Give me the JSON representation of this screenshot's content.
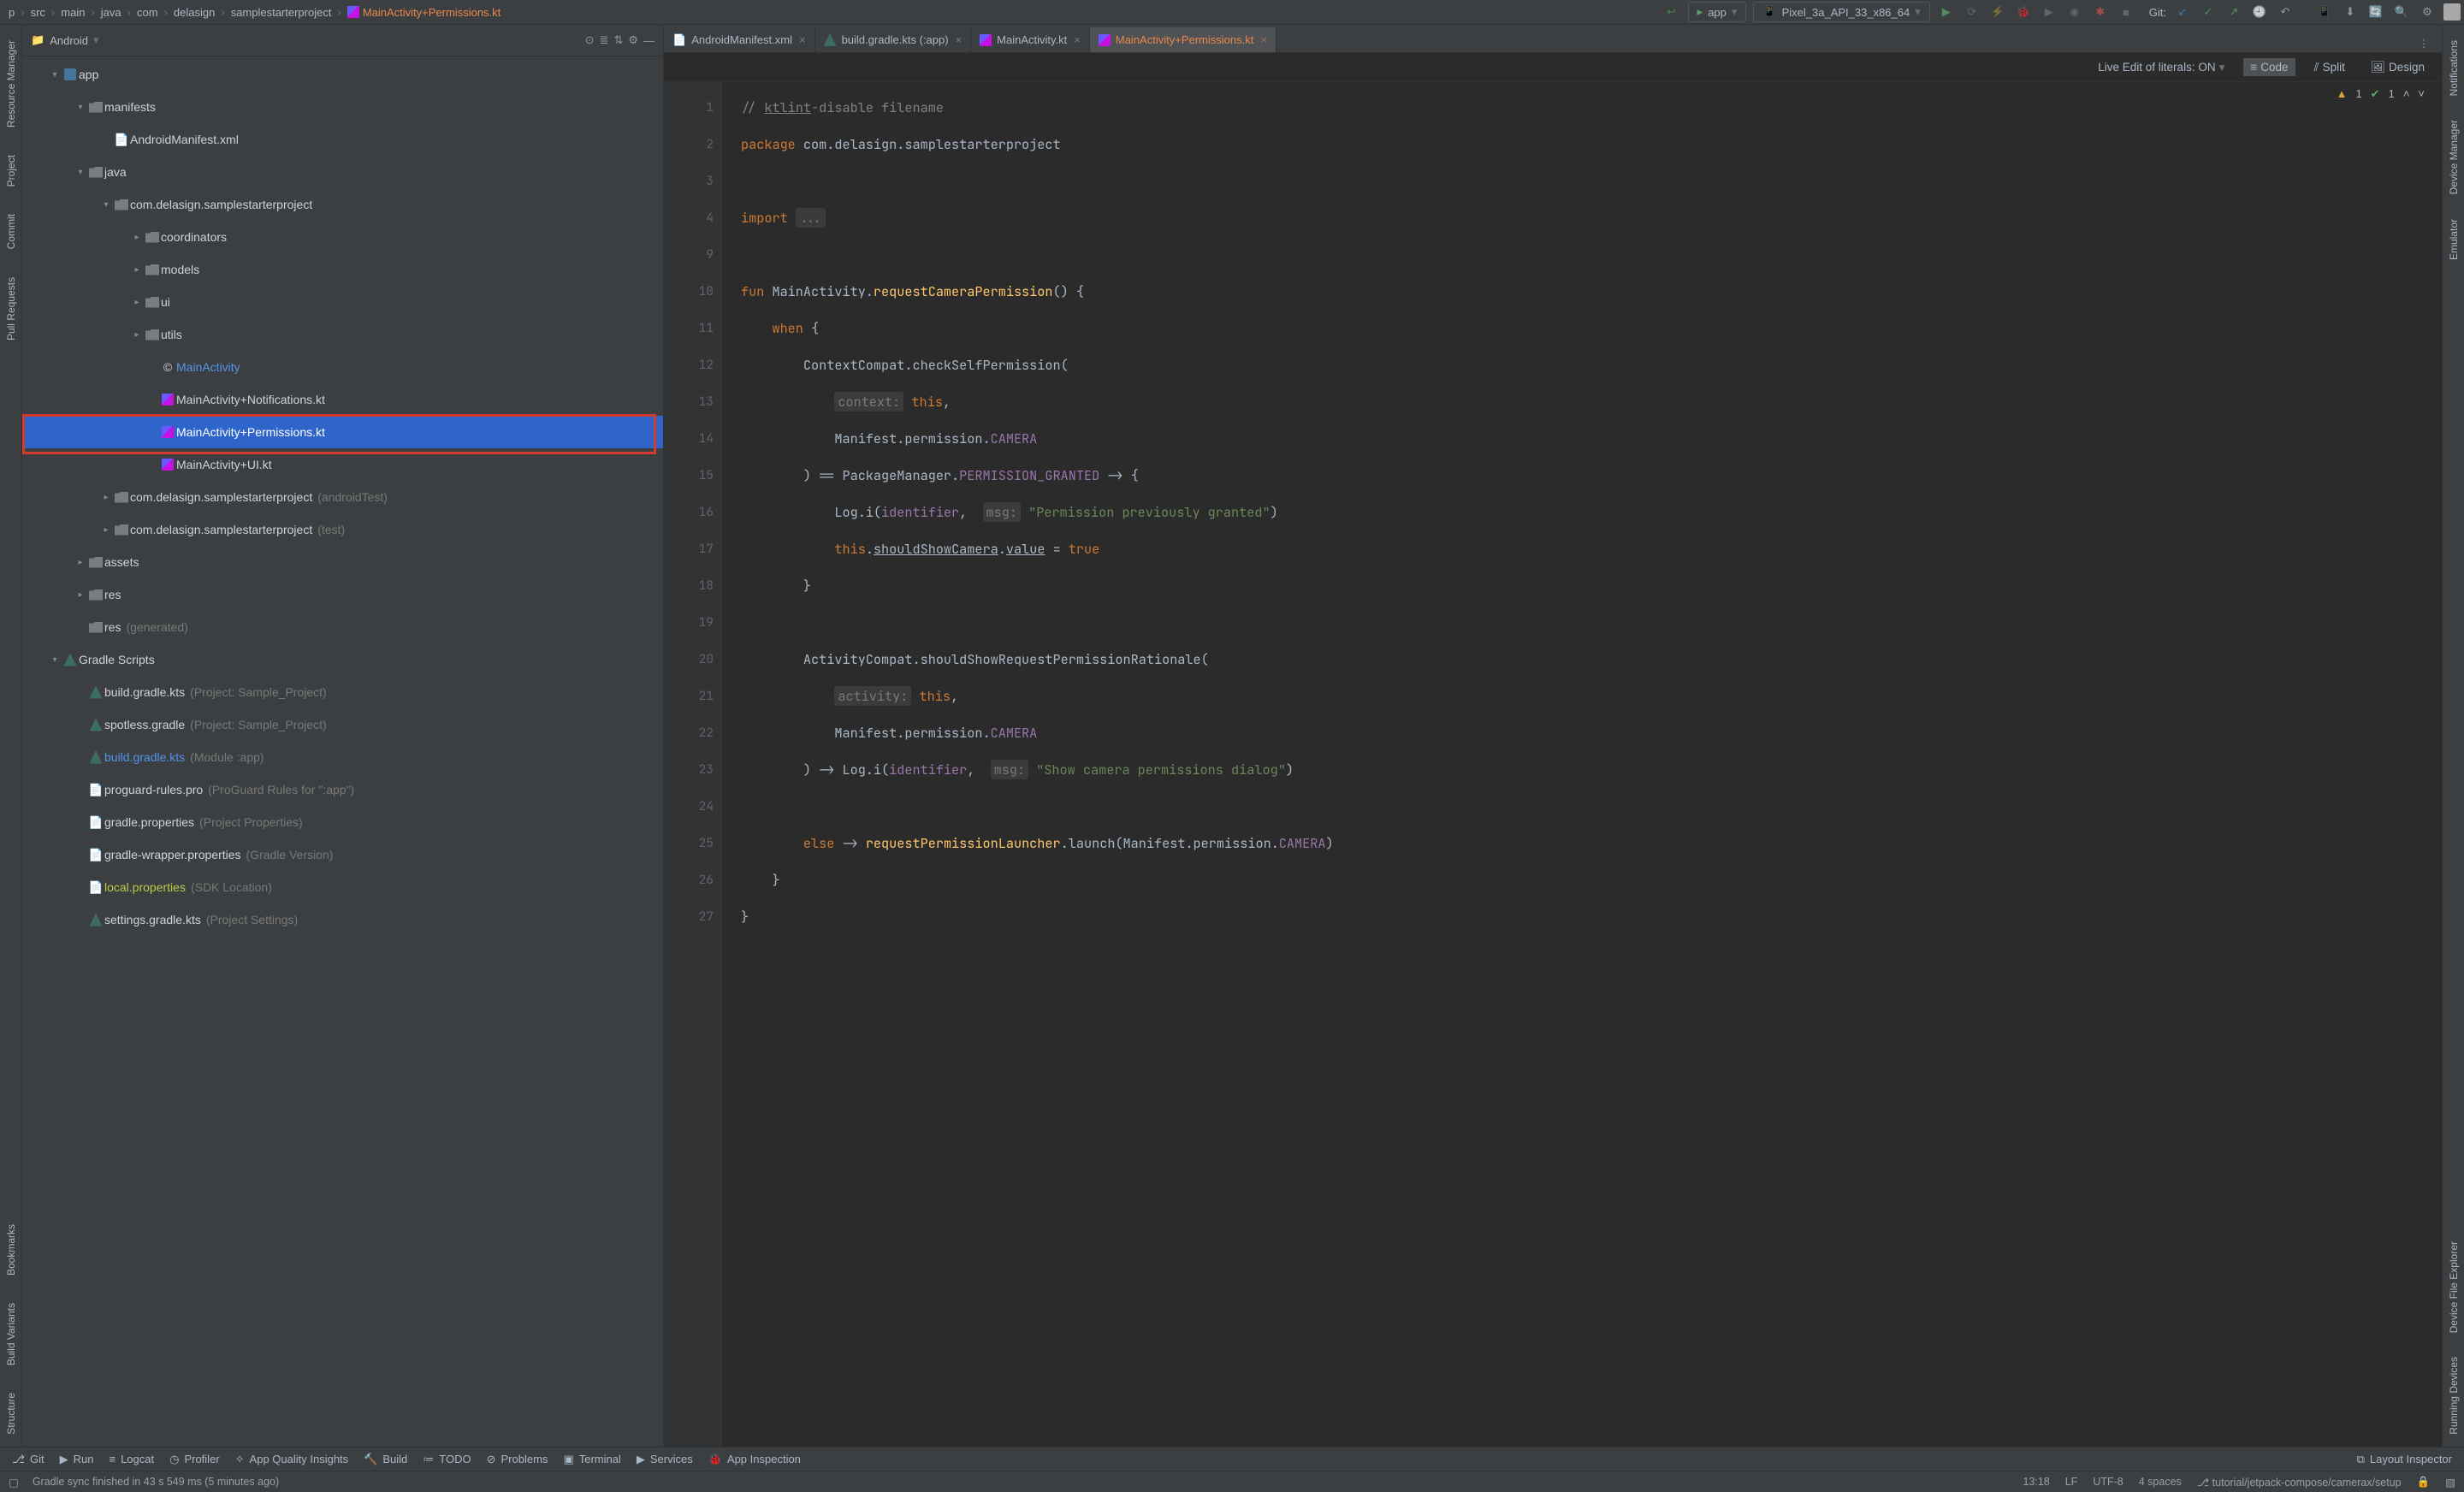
{
  "breadcrumb": [
    "p",
    "src",
    "main",
    "java",
    "com",
    "delasign",
    "samplestarterproject",
    "MainActivity+Permissions.kt"
  ],
  "run_config": "app",
  "emulator": "Pixel_3a_API_33_x86_64",
  "git_label": "Git:",
  "left_tools": [
    "Resource Manager",
    "Project",
    "Commit",
    "Pull Requests",
    "Bookmarks",
    "Build Variants",
    "Structure"
  ],
  "right_tools": [
    "Notifications",
    "Device Manager",
    "Emulator",
    "Device File Explorer",
    "Running Devices"
  ],
  "project_view": "Android",
  "tree": {
    "app": "app",
    "manifests": "manifests",
    "android_manifest": "AndroidManifest.xml",
    "java": "java",
    "pkg": "com.delasign.samplestarterproject",
    "coord": "coordinators",
    "models": "models",
    "ui": "ui",
    "utils": "utils",
    "main_act": "MainActivity",
    "notif": "MainActivity+Notifications.kt",
    "perm": "MainActivity+Permissions.kt",
    "uikt": "MainActivity+UI.kt",
    "pkg_at": "com.delasign.samplestarterproject",
    "pkg_at_s": "(androidTest)",
    "pkg_t": "com.delasign.samplestarterproject",
    "pkg_t_s": "(test)",
    "assets": "assets",
    "res": "res",
    "res_gen": "res",
    "res_gen_s": "(generated)",
    "gradle_scripts": "Gradle Scripts",
    "bg_proj": "build.gradle.kts",
    "bg_proj_s": "(Project: Sample_Project)",
    "spotless": "spotless.gradle",
    "spotless_s": "(Project: Sample_Project)",
    "bg_mod": "build.gradle.kts",
    "bg_mod_s": "(Module :app)",
    "proguard": "proguard-rules.pro",
    "proguard_s": "(ProGuard Rules for \":app\")",
    "gp": "gradle.properties",
    "gp_s": "(Project Properties)",
    "gwp": "gradle-wrapper.properties",
    "gwp_s": "(Gradle Version)",
    "lp": "local.properties",
    "lp_s": "(SDK Location)",
    "sg": "settings.gradle.kts",
    "sg_s": "(Project Settings)"
  },
  "tabs": [
    "AndroidManifest.xml",
    "build.gradle.kts (:app)",
    "MainActivity.kt",
    "MainActivity+Permissions.kt"
  ],
  "live_edit": "Live Edit of literals: ON",
  "modes": {
    "code": "Code",
    "split": "Split",
    "design": "Design"
  },
  "warnings": "1",
  "checks": "1",
  "gutter_lines": [
    "1",
    "2",
    "3",
    "4",
    "9",
    "10",
    "11",
    "12",
    "13",
    "14",
    "15",
    "16",
    "17",
    "18",
    "19",
    "20",
    "21",
    "22",
    "23",
    "24",
    "25",
    "26",
    "27"
  ],
  "bottom": {
    "git": "Git",
    "run": "Run",
    "logcat": "Logcat",
    "profiler": "Profiler",
    "aqi": "App Quality Insights",
    "build": "Build",
    "todo": "TODO",
    "problems": "Problems",
    "terminal": "Terminal",
    "services": "Services",
    "appinsp": "App Inspection",
    "layoutinsp": "Layout Inspector"
  },
  "status": {
    "sync": "Gradle sync finished in 43 s 549 ms (5 minutes ago)",
    "cursor": "13:18",
    "enc": "LF",
    "charset": "UTF-8",
    "indent": "4 spaces",
    "branch": "tutorial/jetpack-compose/camerax/setup"
  },
  "code_html": "<span class='cm'>// <u>ktlint</u>-disable filename</span>\n<span class='kw'>package</span> com.delasign.samplestarterproject\n\n<span class='kw'>import</span> <span class='hint'>...</span>\n\n<span class='kw'>fun</span> MainActivity.<span class='fn'>requestCameraPermission</span>() {\n    <span class='kw'>when</span> {\n        ContextCompat.checkSelfPermission(\n            <span class='hint'>context:</span> <span class='kw'>this</span>,\n            Manifest.permission.<span class='id'>CAMERA</span>\n        ) == PackageManager.<span class='id'>PERMISSION_GRANTED</span> -> {\n            Log.i(<span class='id'>identifier</span>,  <span class='hint'>msg:</span> <span class='str'>\"Permission previously granted\"</span>)\n            <span class='kw'>this</span>.<span class='hl'>shouldShowCamera</span>.<span class='hl'>value</span> = <span class='kw'>true</span>\n        }\n\n        ActivityCompat.shouldShowRequestPermissionRationale(\n            <span class='hint'>activity:</span> <span class='kw'>this</span>,\n            Manifest.permission.<span class='id'>CAMERA</span>\n        ) -> Log.i(<span class='id'>identifier</span>,  <span class='hint'>msg:</span> <span class='str'>\"Show camera permissions dialog\"</span>)\n\n        <span class='kw'>else</span> -> <span class='fn'>requestPermissionLauncher</span>.launch(Manifest.permission.<span class='id'>CAMERA</span>)\n    }\n}"
}
